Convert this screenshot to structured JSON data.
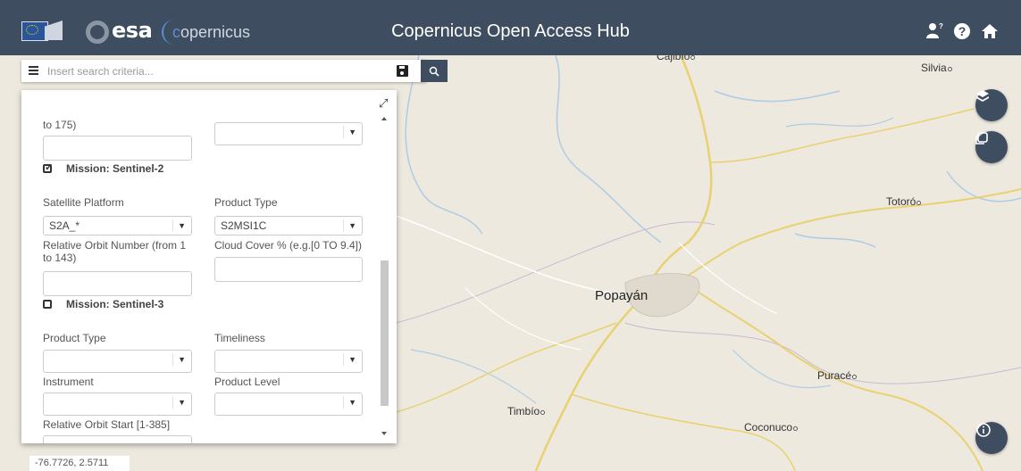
{
  "header": {
    "title": "Copernicus Open Access Hub",
    "esa_logo_text": "esa",
    "copernicus_logo_text": "opernicus",
    "brand_color": "#3e4e60",
    "icons": [
      "user-help-icon",
      "help-icon",
      "home-icon"
    ]
  },
  "search": {
    "placeholder": "Insert search criteria...",
    "value": ""
  },
  "panel": {
    "top_label": "to 175)",
    "missions": [
      {
        "name": "Mission: Sentinel-2",
        "checked": true,
        "satellite_platform_label": "Satellite Platform",
        "satellite_platform_value": "S2A_*",
        "product_type_label": "Product Type",
        "product_type_value": "S2MSI1C",
        "relative_orbit_label": "Relative Orbit Number (from 1 to 143)",
        "cloud_cover_label": "Cloud Cover % (e.g.[0 TO 9.4])"
      },
      {
        "name": "Mission: Sentinel-3",
        "checked": false,
        "product_type_label": "Product Type",
        "timeliness_label": "Timeliness",
        "instrument_label": "Instrument",
        "product_level_label": "Product Level",
        "relative_orbit_start_label": "Relative Orbit Start [1-385]"
      }
    ]
  },
  "map": {
    "places": [
      "Cajibío",
      "Silvia",
      "Totoró",
      "Popayán",
      "Puracé",
      "Timbío",
      "Coconuco"
    ],
    "coordinates": "-76.7726, 2.5711",
    "road_color": "#e8d170",
    "water_color": "#aecbe6"
  }
}
